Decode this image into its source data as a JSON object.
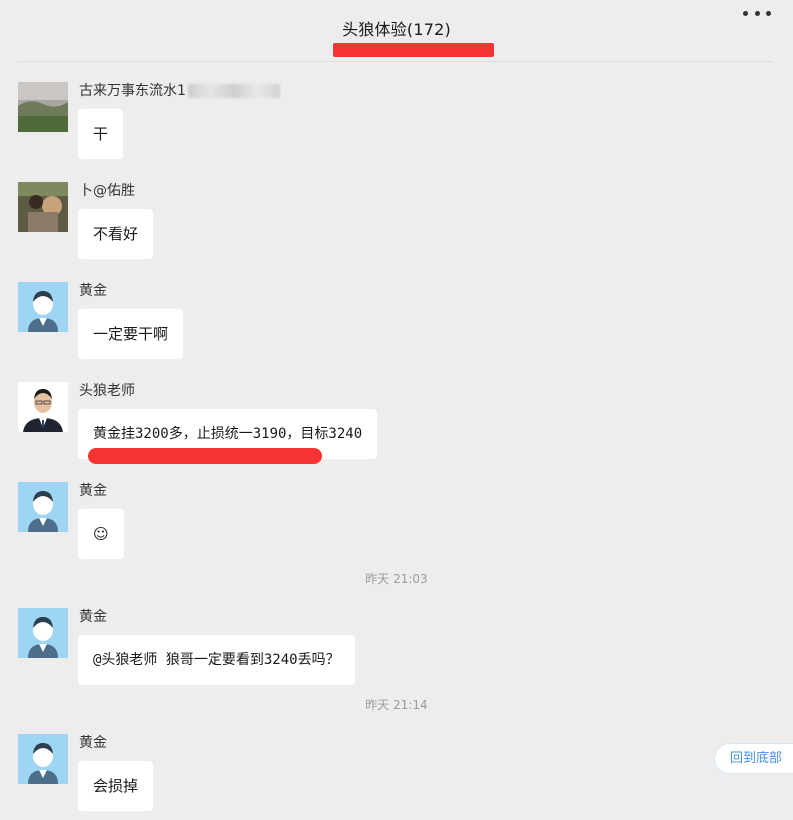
{
  "header": {
    "title": "头狼体验",
    "count": "(172)"
  },
  "messages": [
    {
      "sender": "古来万事东流水1",
      "text": "干",
      "avatar": "landscape-photo"
    },
    {
      "sender": "卜@佑胜",
      "text": "不看好",
      "avatar": "dog-photo"
    },
    {
      "sender": "黄金",
      "text": "一定要干啊",
      "avatar": "default-avatar"
    },
    {
      "sender": "头狼老师",
      "text": "黄金挂3200多，止损统一3190，目标3240",
      "avatar": "man-portrait"
    },
    {
      "sender": "黄金",
      "text": "☺",
      "avatar": "default-avatar"
    },
    {
      "sender": "黄金",
      "text": "@头狼老师 狼哥一定要看到3240丢吗？",
      "avatar": "default-avatar"
    },
    {
      "sender": "黄金",
      "text": "会损掉",
      "avatar": "default-avatar"
    }
  ],
  "timestamps": [
    "昨天 21:03",
    "昨天 21:14"
  ],
  "back_to_bottom": "回到底部",
  "colors": {
    "background": "#ededed",
    "bubble": "#ffffff",
    "highlight": "#f73434",
    "link": "#4a90d9",
    "avatar_bg": "#9dd5f2"
  }
}
